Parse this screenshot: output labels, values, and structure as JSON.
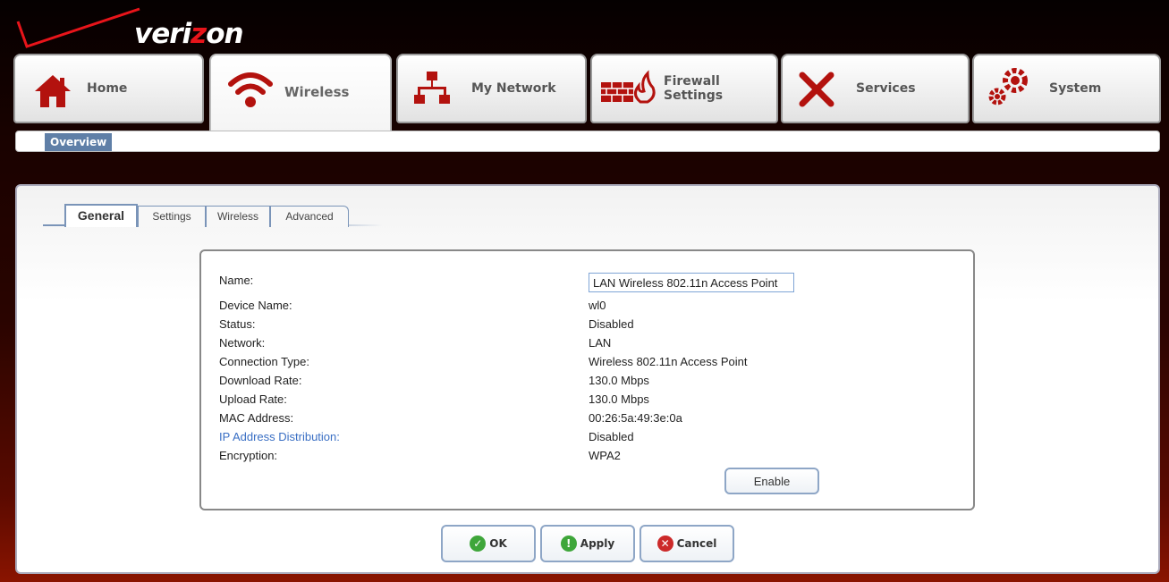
{
  "brand": {
    "logo_text_a": "veri",
    "logo_text_z": "z",
    "logo_text_b": "on"
  },
  "nav": {
    "tabs": [
      {
        "label": "Home",
        "icon": "home-icon"
      },
      {
        "label": "Wireless",
        "icon": "wifi-icon",
        "active": true
      },
      {
        "label": "My Network",
        "icon": "network-icon"
      },
      {
        "label": "Firewall Settings",
        "icon": "firewall-icon"
      },
      {
        "label": "Services",
        "icon": "tools-icon"
      },
      {
        "label": "System",
        "icon": "gears-icon"
      }
    ]
  },
  "subnav": {
    "overview": "Overview"
  },
  "subtabs": [
    {
      "label": "General",
      "active": true
    },
    {
      "label": "Settings"
    },
    {
      "label": "Wireless"
    },
    {
      "label": "Advanced"
    }
  ],
  "details": {
    "name_label": "Name:",
    "name_value": "LAN Wireless 802.11n Access Point",
    "rows": [
      {
        "label": "Device Name:",
        "value": "wl0"
      },
      {
        "label": "Status:",
        "value": "Disabled"
      },
      {
        "label": "Network:",
        "value": "LAN"
      },
      {
        "label": "Connection Type:",
        "value": "Wireless 802.11n Access Point"
      },
      {
        "label": "Download Rate:",
        "value": "130.0 Mbps"
      },
      {
        "label": "Upload Rate:",
        "value": "130.0 Mbps"
      },
      {
        "label": "MAC Address:",
        "value": "00:26:5a:49:3e:0a"
      },
      {
        "label": "IP Address Distribution:",
        "value": "Disabled"
      },
      {
        "label": "Encryption:",
        "value": "WPA2"
      }
    ],
    "enable_label": "Enable"
  },
  "actions": {
    "ok": "OK",
    "apply": "Apply",
    "cancel": "Cancel"
  },
  "colors": {
    "accent": "#5f7fa7",
    "brand_red": "#e8141a",
    "link": "#3a6fc4"
  }
}
